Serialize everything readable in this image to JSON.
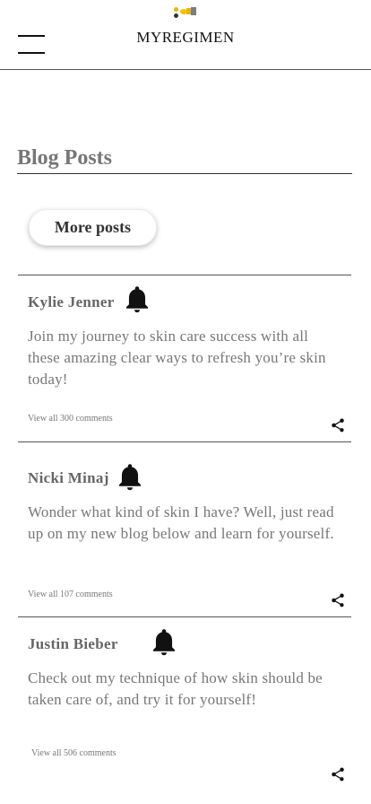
{
  "header": {
    "title": "MYREGIMEN"
  },
  "section": {
    "title": "Blog Posts",
    "more_button": "More posts"
  },
  "posts": [
    {
      "author": "Kylie Jenner",
      "body": "Join my journey to skin care success with all these amazing clear ways to refresh you’re skin today!",
      "comments": "View all 300 comments"
    },
    {
      "author": "Nicki Minaj",
      "body": "Wonder what kind of skin I have? Well, just read up on my new blog below and learn for yourself.",
      "comments": "View all 107 comments"
    },
    {
      "author": "Justin Bieber",
      "body": "Check out my technique of how skin should be taken care of, and try it for yourself!",
      "comments": "View all 506 comments"
    }
  ],
  "icons": {
    "menu": "hamburger-menu-icon",
    "bell": "bell-icon",
    "share": "share-icon"
  },
  "colors": {
    "status_accent": "#f2c200"
  }
}
